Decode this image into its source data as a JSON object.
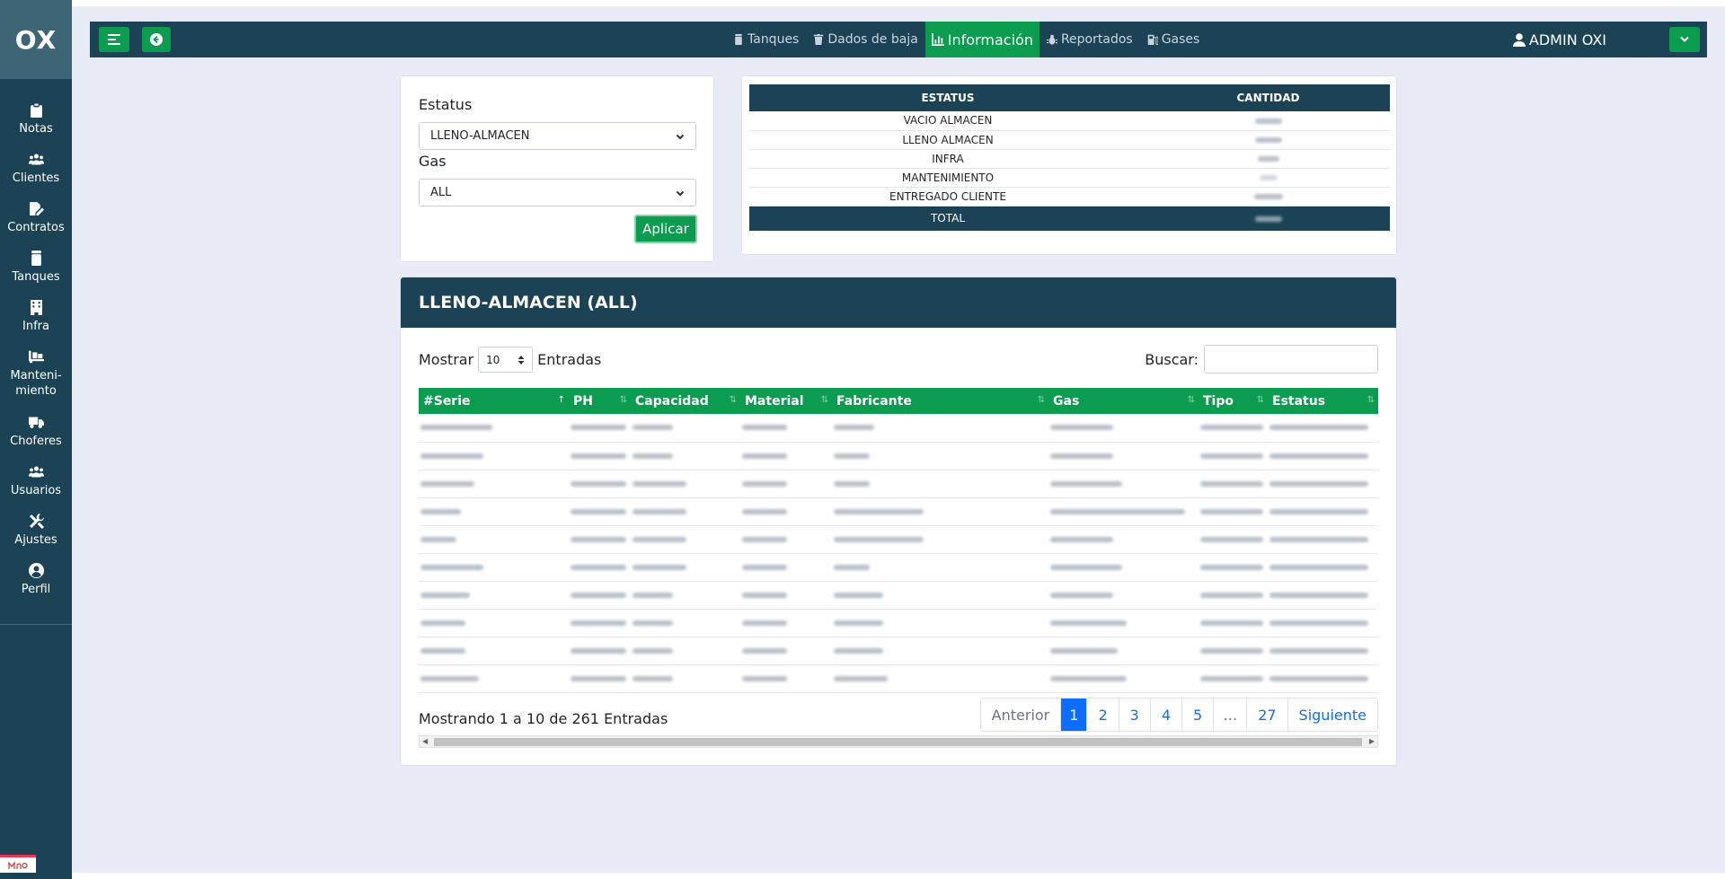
{
  "brand": "OX",
  "sidebar": {
    "items": [
      {
        "label": "Notas",
        "icon": "clipboard-icon"
      },
      {
        "label": "Clientes",
        "icon": "users-icon"
      },
      {
        "label": "Contratos",
        "icon": "file-signature-icon"
      },
      {
        "label": "Tanques",
        "icon": "tank-icon"
      },
      {
        "label": "Infra",
        "icon": "building-icon"
      },
      {
        "label": "Manteni-\nmiento",
        "icon": "dolly-icon"
      },
      {
        "label": "Choferes",
        "icon": "truck-icon"
      },
      {
        "label": "Usuarios",
        "icon": "user-group-icon"
      },
      {
        "label": "Ajustes",
        "icon": "tools-icon"
      },
      {
        "label": "Perfil",
        "icon": "user-circle-icon"
      }
    ]
  },
  "topbar": {
    "nav": [
      {
        "label": "Tanques",
        "icon": "tank-icon",
        "active": false
      },
      {
        "label": "Dados de baja",
        "icon": "trash-icon",
        "active": false
      },
      {
        "label": "Información",
        "icon": "chart-icon",
        "active": true
      },
      {
        "label": "Reportados",
        "icon": "bug-icon",
        "active": false
      },
      {
        "label": "Gases",
        "icon": "gas-icon",
        "active": false
      }
    ],
    "user": "ADMIN OXI"
  },
  "filter": {
    "estatus_label": "Estatus",
    "estatus_value": "LLENO-ALMACEN",
    "gas_label": "Gas",
    "gas_value": "ALL",
    "apply_label": "Aplicar"
  },
  "summary": {
    "headers": [
      "ESTATUS",
      "CANTIDAD"
    ],
    "rows": [
      "VACIO ALMACEN",
      "LLENO ALMACEN",
      "INFRA",
      "MANTENIMIENTO",
      "ENTREGADO CLIENTE"
    ],
    "total_label": "TOTAL"
  },
  "list": {
    "title": "LLENO-ALMACEN (ALL)",
    "show_label": "Mostrar",
    "show_value": "10",
    "entries_label": "Entradas",
    "search_label": "Buscar:",
    "columns": [
      "#Serie",
      "PH",
      "Capacidad",
      "Material",
      "Fabricante",
      "Gas",
      "Tipo",
      "Estatus"
    ],
    "info": "Mostrando 1 a 10 de 261 Entradas",
    "pagination": {
      "prev": "Anterior",
      "pages": [
        "1",
        "2",
        "3",
        "4",
        "5",
        "…",
        "27"
      ],
      "next": "Siguiente",
      "current": "1"
    }
  },
  "colors": {
    "navy": "#1b4355",
    "green": "#0c9c4f",
    "blue": "#0d6efd",
    "background": "#e9ecf7"
  }
}
